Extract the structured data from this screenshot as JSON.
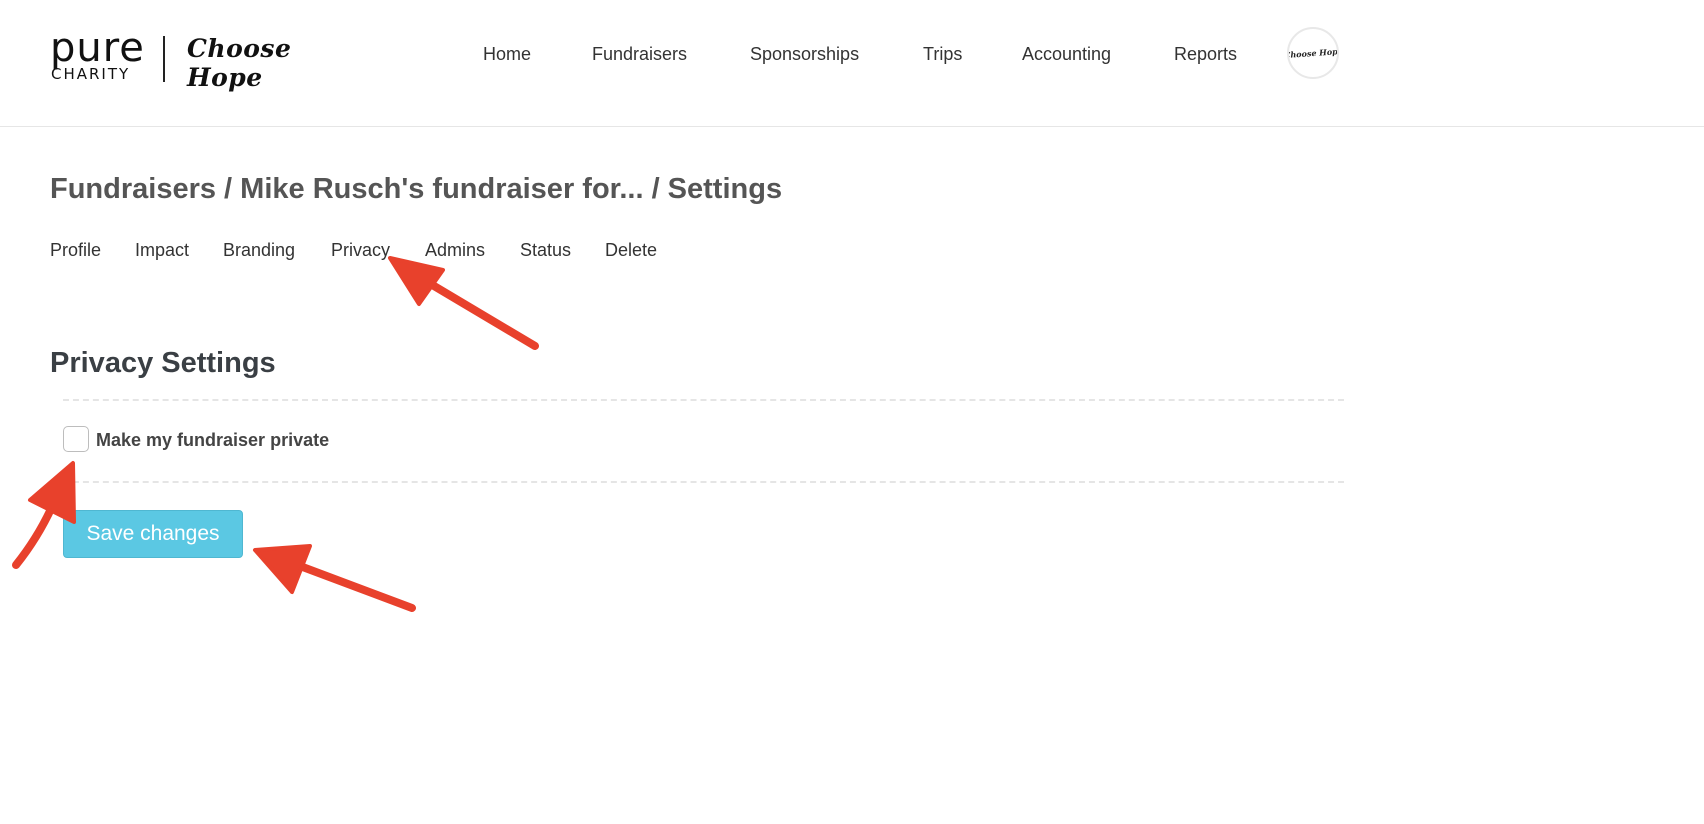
{
  "brand": {
    "name_top": "pure",
    "name_bottom": "CHARITY",
    "partner": "Choose Hope"
  },
  "nav": {
    "items": [
      {
        "label": "Home"
      },
      {
        "label": "Fundraisers"
      },
      {
        "label": "Sponsorships"
      },
      {
        "label": "Trips"
      },
      {
        "label": "Accounting"
      },
      {
        "label": "Reports"
      }
    ],
    "avatar_text": "Choose Hope"
  },
  "page": {
    "breadcrumb_title": "Fundraisers / Mike Rusch's fundraiser for... / Settings"
  },
  "tabs": [
    {
      "label": "Profile"
    },
    {
      "label": "Impact"
    },
    {
      "label": "Branding"
    },
    {
      "label": "Privacy"
    },
    {
      "label": "Admins"
    },
    {
      "label": "Status"
    },
    {
      "label": "Delete"
    }
  ],
  "privacy": {
    "title": "Privacy Settings",
    "private_checkbox_label": "Make my fundraiser private",
    "private_checked": false,
    "save_label": "Save changes"
  },
  "colors": {
    "accent_button": "#5bc8e3",
    "annotation_arrow": "#e8412c"
  }
}
